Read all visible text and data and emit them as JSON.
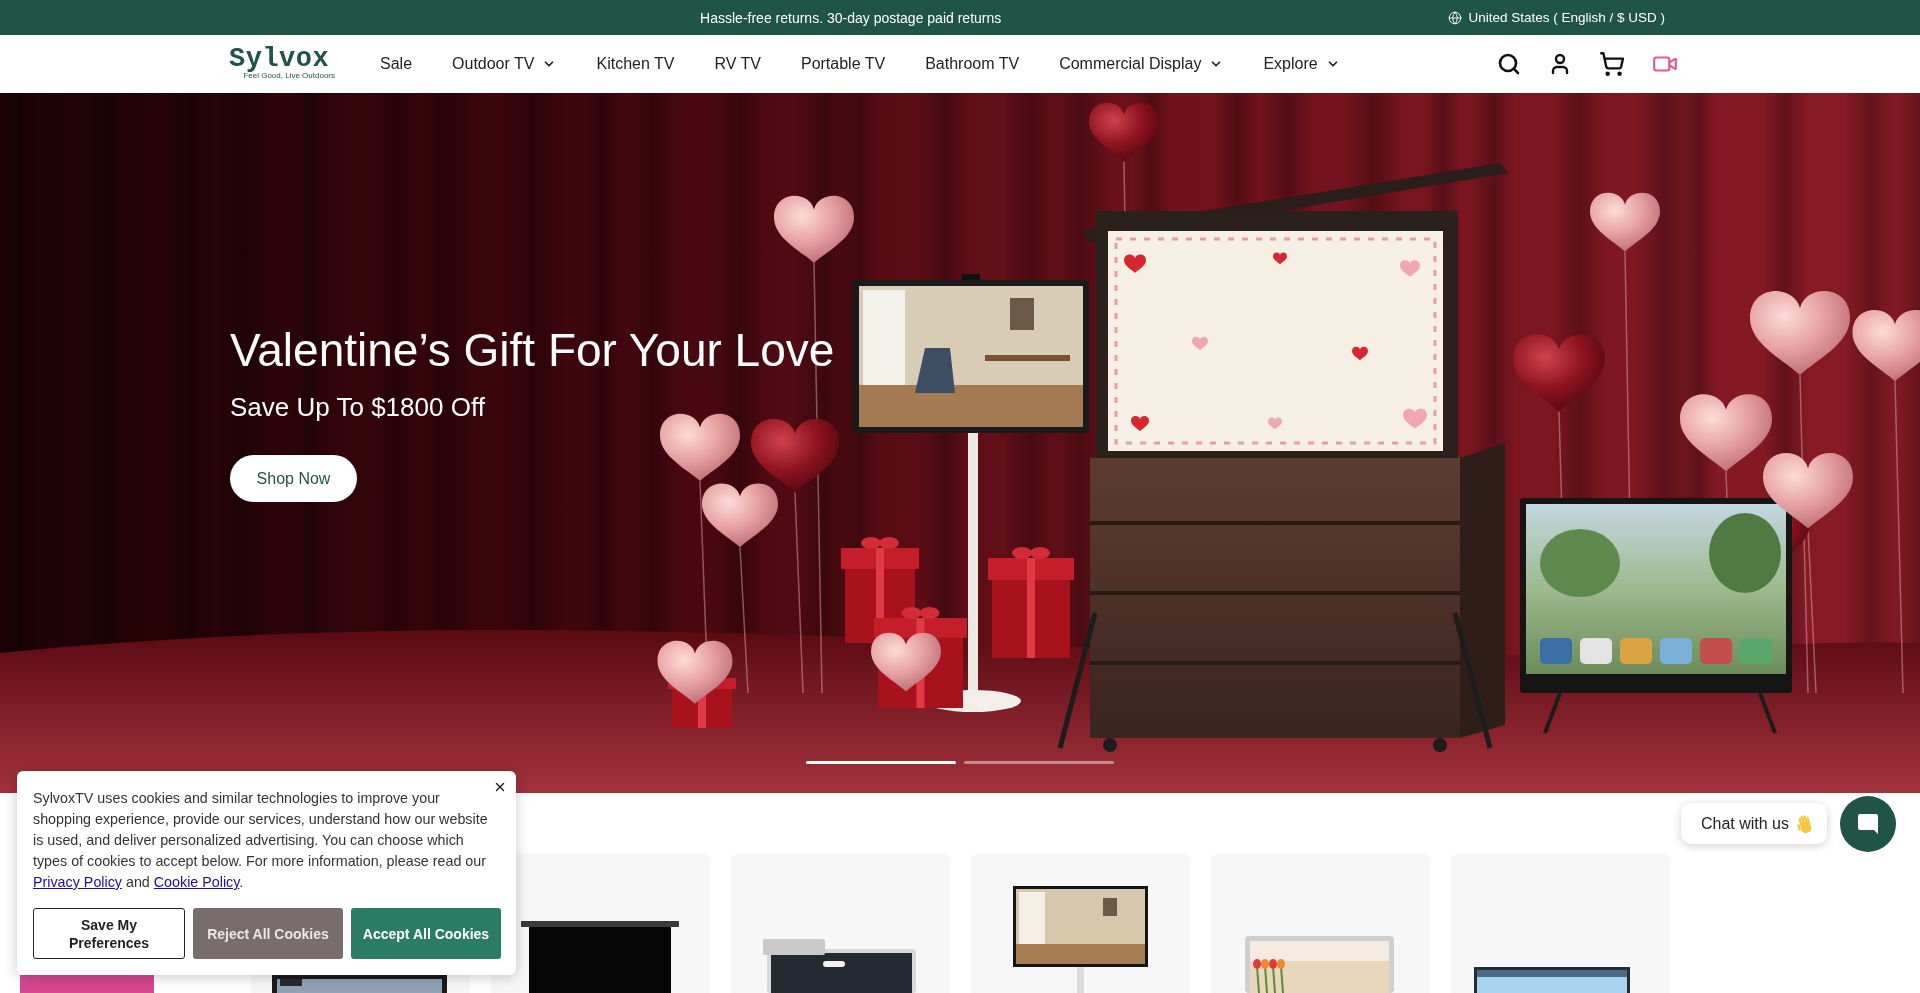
{
  "top_bar": {
    "announcement": "Hassle-free returns. 30-day postage paid returns",
    "locale": "United States ( English / $ USD )"
  },
  "header": {
    "logo": {
      "name": "Sylvox",
      "tagline": "Feel Good, Live Outdoors"
    },
    "nav": [
      {
        "label": "Sale",
        "dropdown": false
      },
      {
        "label": "Outdoor TV",
        "dropdown": true
      },
      {
        "label": "Kitchen TV",
        "dropdown": false
      },
      {
        "label": "RV TV",
        "dropdown": false
      },
      {
        "label": "Portable TV",
        "dropdown": false
      },
      {
        "label": "Bathroom TV",
        "dropdown": false
      },
      {
        "label": "Commercial Display",
        "dropdown": true
      },
      {
        "label": "Explore",
        "dropdown": true
      }
    ]
  },
  "hero": {
    "title": "Valentine’s Gift For Your Love",
    "subtitle": "Save Up To $1800 Off",
    "button": "Shop Now",
    "slides": [
      {
        "selected": true
      },
      {
        "selected": false
      }
    ]
  },
  "products": [
    {
      "kind": "wall"
    },
    {
      "kind": "cabinet"
    },
    {
      "kind": "monitor"
    },
    {
      "kind": "stand"
    },
    {
      "kind": "mirror"
    },
    {
      "kind": "smart"
    }
  ],
  "cookie_banner": {
    "message": [
      {
        "kind": "text",
        "text": "SylvoxTV uses cookies and similar technologies to improve your shopping experience, provide our services, understand how our website is used, and deliver personalized advertising. You can choose which types of cookies to accept below. For more information, please read our "
      },
      {
        "kind": "link",
        "text": "Privacy Policy"
      },
      {
        "kind": "text",
        "text": " and "
      },
      {
        "kind": "link",
        "text": "Cookie Policy"
      },
      {
        "kind": "text",
        "text": "."
      }
    ],
    "buttons": [
      {
        "label": "Save My Preferences",
        "kind": "outline"
      },
      {
        "label": "Reject All Cookies",
        "kind": "muted"
      },
      {
        "label": "Accept All Cookies",
        "kind": "primary"
      }
    ]
  },
  "chat": {
    "label": "Chat with us"
  }
}
